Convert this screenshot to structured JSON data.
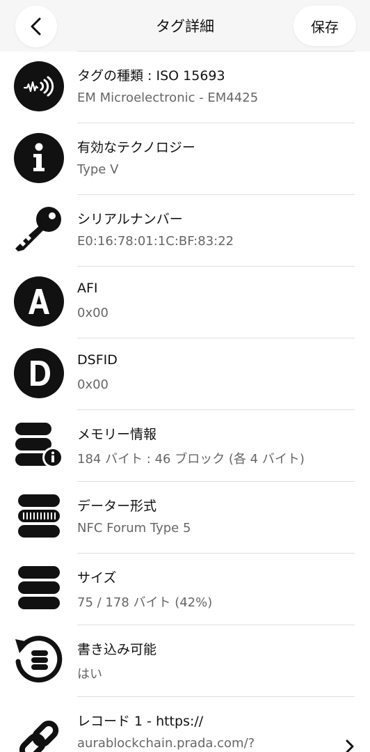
{
  "header": {
    "title": "タグ詳細",
    "save_label": "保存"
  },
  "rows": [
    {
      "icon": "nfc-wave-icon",
      "label": "タグの種類 : ISO 15693",
      "value": "EM Microelectronic - EM4425"
    },
    {
      "icon": "info-icon",
      "label": "有効なテクノロジー",
      "value": "Type V"
    },
    {
      "icon": "key-icon",
      "label": "シリアルナンバー",
      "value": "E0:16:78:01:1C:BF:83:22"
    },
    {
      "icon": "letter-a-icon",
      "label": "AFI",
      "value": "0x00"
    },
    {
      "icon": "letter-d-icon",
      "label": "DSFID",
      "value": "0x00"
    },
    {
      "icon": "database-info-icon",
      "label": "メモリー情報",
      "value": "184 バイト : 46 ブロック (各 4 バイト)"
    },
    {
      "icon": "database-format-icon",
      "label": "データー形式",
      "value": "NFC Forum Type 5"
    },
    {
      "icon": "database-icon",
      "label": "サイズ",
      "value": "75 / 178 バイト (42%)"
    },
    {
      "icon": "database-refresh-icon",
      "label": "書き込み可能",
      "value": "はい"
    },
    {
      "icon": "link-icon",
      "label": "レコード 1 - https://",
      "value": "aurablockchain.prada.com/?"
    }
  ]
}
